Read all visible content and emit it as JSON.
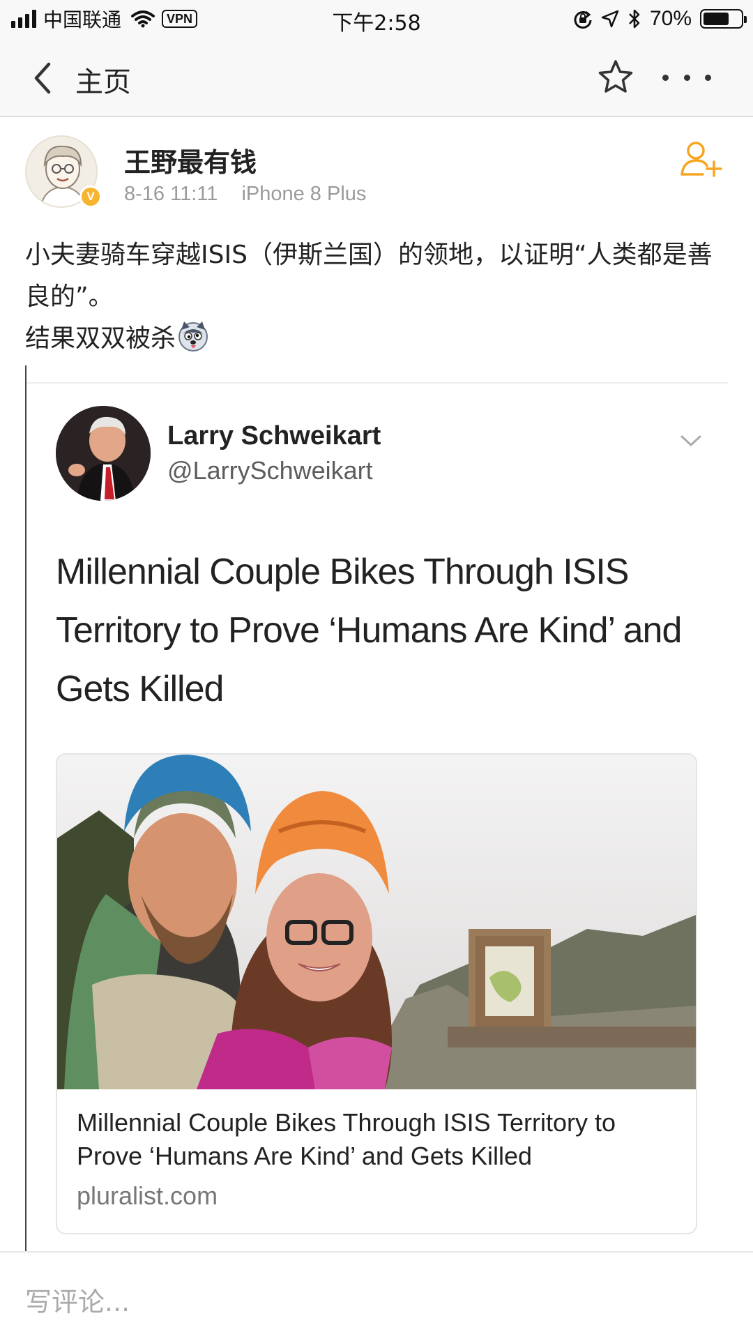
{
  "status_bar": {
    "carrier": "中国联通",
    "vpn": "VPN",
    "time": "下午2:58",
    "battery": "70%",
    "battery_level": 0.7
  },
  "nav": {
    "title": "主页"
  },
  "post": {
    "author": "王野最有钱",
    "verified_mark": "V",
    "time": "8-16 11:11",
    "device": "iPhone 8 Plus",
    "text_lines": [
      "小夫妻骑车穿越ISIS（伊斯兰国）的领地，以证明“人类都是善良的”。",
      "结果双双被杀"
    ]
  },
  "quote": {
    "name": "Larry Schweikart",
    "handle": "@LarrySchweikart",
    "headline": "Millennial Couple Bikes Through ISIS Territory to Prove ‘Humans Are Kind’ and Gets Killed",
    "link": {
      "title": "Millennial Couple Bikes Through ISIS Territory to Prove ‘Humans Are Kind’ and Gets Killed",
      "domain": "pluralist.com"
    }
  },
  "comment": {
    "placeholder": "写评论..."
  },
  "colors": {
    "accent": "#f6a623",
    "nav_bg": "#f8f8f8",
    "meta_text": "#9a9a9a"
  },
  "icons": [
    "signal-icon",
    "wifi-icon",
    "lock-rotation-icon",
    "location-icon",
    "bluetooth-icon",
    "battery-icon",
    "back-chevron-icon",
    "star-icon",
    "more-icon",
    "add-friend-icon",
    "dog-emoji-icon",
    "chevron-down-icon"
  ]
}
